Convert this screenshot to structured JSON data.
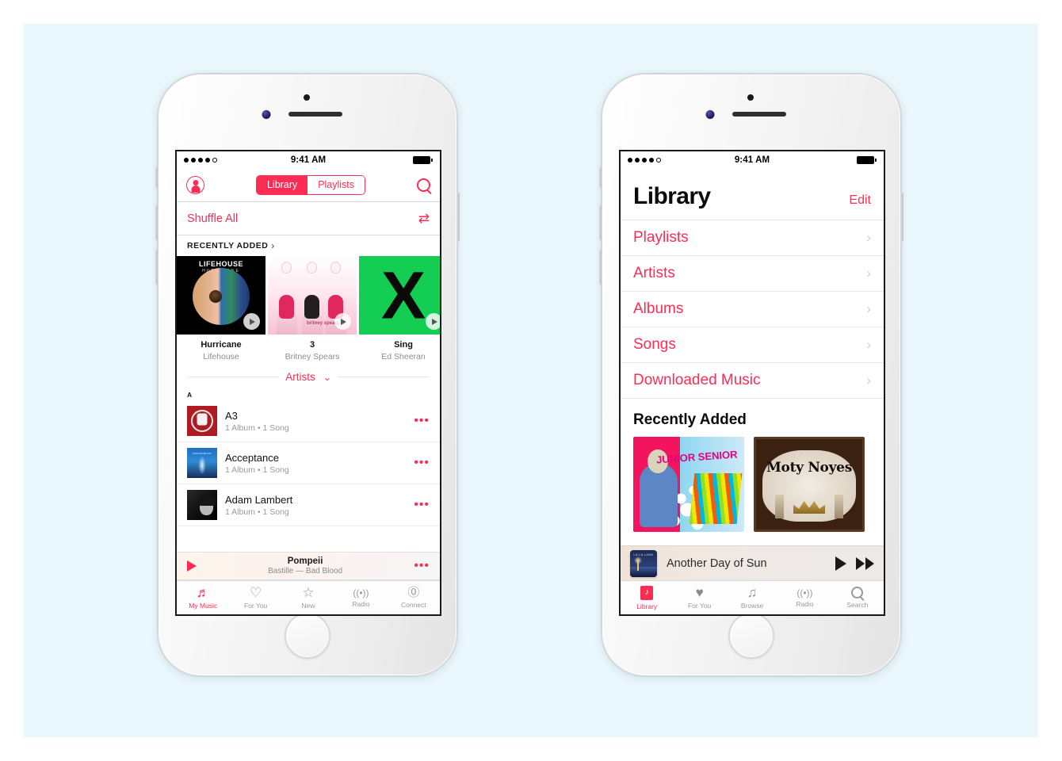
{
  "page": {
    "background_color": "#eaf7fd",
    "accent_color": "#fb2d55"
  },
  "phone_left": {
    "status_bar": {
      "signal_dots": 5,
      "signal_filled": 4,
      "time": "9:41 AM",
      "battery": "full"
    },
    "navbar": {
      "profile_icon": "profile-circle-icon",
      "segments": [
        {
          "label": "Library",
          "active": true
        },
        {
          "label": "Playlists",
          "active": false
        }
      ],
      "search_icon": "search-icon"
    },
    "shuffle": {
      "label": "Shuffle All",
      "icon": "shuffle-icon",
      "glyph": "⤫"
    },
    "recently_added": {
      "header": "RECENTLY ADDED",
      "chevron": "›"
    },
    "albums": [
      {
        "title": "Hurricane",
        "artist": "Lifehouse",
        "art": "lifehouse-hurricane-eye-globe",
        "overlay_text": "LIFEHOUSE",
        "overlay_sub": "HURRICANE",
        "play_button": true
      },
      {
        "title": "3",
        "artist": "Britney Spears",
        "art": "britney-spears-3-corsets",
        "logo": "britney spears",
        "play_button": true
      },
      {
        "title": "Sing",
        "artist": "Ed Sheeran",
        "art": "ed-sheeran-x-green",
        "big_letter": "X",
        "play_button": true
      }
    ],
    "section_picker": {
      "label": "Artists",
      "caret": "⌄"
    },
    "index_letter": "A",
    "artists": [
      {
        "name": "A3",
        "detail": "1 Album • 1 Song",
        "art": "a3-red-fist",
        "more": "•••"
      },
      {
        "name": "Acceptance",
        "detail": "1 Album • 1 Song",
        "art": "acceptance-blue-light",
        "more": "•••"
      },
      {
        "name": "Adam Lambert",
        "detail": "1 Album • 1 Song",
        "art": "adam-lambert-portrait",
        "more": "•••"
      }
    ],
    "mini_player": {
      "title": "Pompeii",
      "subtitle": "Bastille — Bad Blood",
      "play_icon": "play-icon",
      "more": "•••"
    },
    "tabs": [
      {
        "label": "My Music",
        "icon": "music-note-icon",
        "glyph": "♬",
        "active": true
      },
      {
        "label": "For You",
        "icon": "heart-outline-icon",
        "glyph": "♡",
        "active": false
      },
      {
        "label": "New",
        "icon": "star-outline-icon",
        "glyph": "☆",
        "active": false
      },
      {
        "label": "Radio",
        "icon": "radio-waves-icon",
        "glyph": "((•))",
        "active": false
      },
      {
        "label": "Connect",
        "icon": "at-sign-icon",
        "glyph": "@",
        "active": false
      }
    ]
  },
  "phone_right": {
    "status_bar": {
      "signal_dots": 5,
      "signal_filled": 4,
      "time": "9:41 AM",
      "battery": "full"
    },
    "header": {
      "title": "Library",
      "edit_label": "Edit"
    },
    "library_items": [
      {
        "label": "Playlists",
        "chevron": "›"
      },
      {
        "label": "Artists",
        "chevron": "›"
      },
      {
        "label": "Albums",
        "chevron": "›"
      },
      {
        "label": "Songs",
        "chevron": "›"
      },
      {
        "label": "Downloaded Music",
        "chevron": "›"
      }
    ],
    "recently_added": {
      "title": "Recently Added",
      "albums": [
        {
          "art": "junior-senior-colorful",
          "text": "JUNIOR SENIOR"
        },
        {
          "art": "moty-noyes-ornate",
          "text": "Moty Noyes"
        }
      ]
    },
    "mini_player": {
      "title": "Another Day of Sun",
      "art": "lalaland-night-city",
      "play_icon": "play-icon",
      "forward_icon": "fast-forward-icon"
    },
    "tabs": [
      {
        "label": "Library",
        "icon": "library-icon",
        "glyph": "♪",
        "active": true
      },
      {
        "label": "For You",
        "icon": "heart-filled-icon",
        "glyph": "♥",
        "active": false
      },
      {
        "label": "Browse",
        "icon": "music-note-icon",
        "glyph": "♫",
        "active": false
      },
      {
        "label": "Radio",
        "icon": "radio-waves-icon",
        "glyph": "((•))",
        "active": false
      },
      {
        "label": "Search",
        "icon": "search-icon",
        "glyph": "",
        "active": false
      }
    ]
  }
}
